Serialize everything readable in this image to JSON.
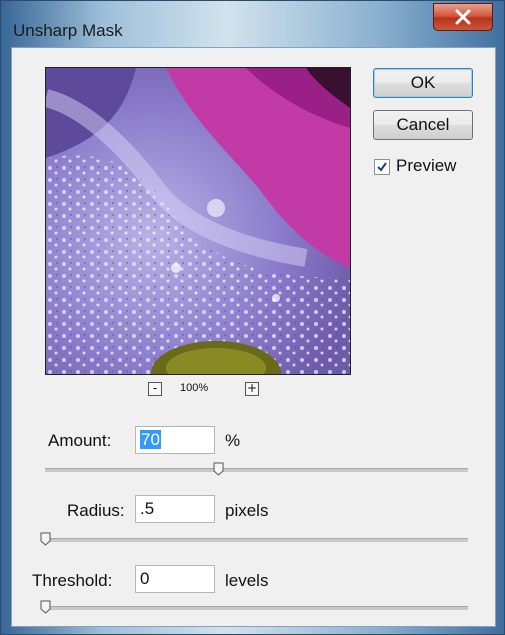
{
  "window": {
    "title": "Unsharp Mask"
  },
  "buttons": {
    "ok": "OK",
    "cancel": "Cancel"
  },
  "preview": {
    "label": "Preview",
    "checked": true
  },
  "zoom": {
    "minus": "-",
    "plus": "+",
    "level": "100%"
  },
  "amount": {
    "label": "Amount:",
    "value": "70",
    "unit": "%",
    "slider_fraction": 0.41
  },
  "radius": {
    "label": "Radius:",
    "value": ".5",
    "unit": "pixels",
    "slider_fraction": 0.0
  },
  "threshold": {
    "label": "Threshold:",
    "value": "0",
    "unit": "levels",
    "slider_fraction": 0.0
  },
  "icons": {
    "close": "close-icon",
    "check": "checkmark-icon"
  }
}
